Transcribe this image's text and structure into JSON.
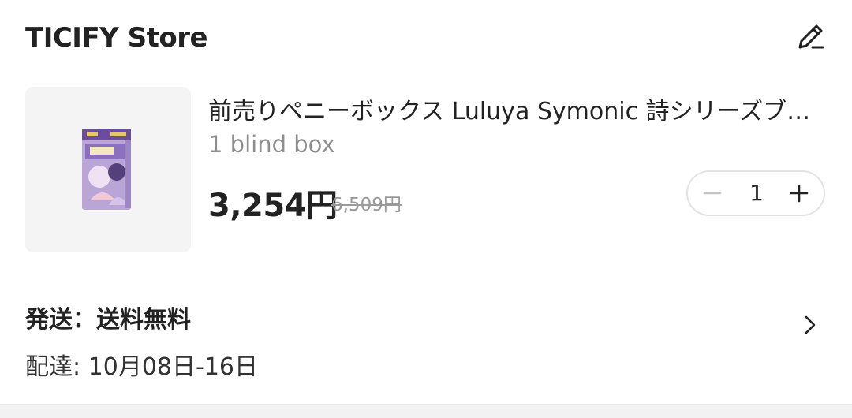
{
  "store": {
    "name": "TICIFY Store",
    "edit_icon": "pencil-icon"
  },
  "product": {
    "title": "前売りペニーボックス Luluya Symonic 詩シリーズブラインドボックス",
    "variant": "1 blind box",
    "price": "3,254円",
    "original_price": "6,509円",
    "image_icon": "blind-box-thumbnail"
  },
  "quantity": {
    "value": "1",
    "minus_icon": "minus-icon",
    "plus_icon": "plus-icon"
  },
  "shipping": {
    "label": "発送：送料無料",
    "delivery": "配達: 10月08日-16日",
    "chevron_icon": "chevron-right-icon"
  },
  "colors": {
    "text": "#222222",
    "muted": "#8e8e8e",
    "border": "#e3e3e3",
    "thumb_bg": "#f4f4f4"
  }
}
